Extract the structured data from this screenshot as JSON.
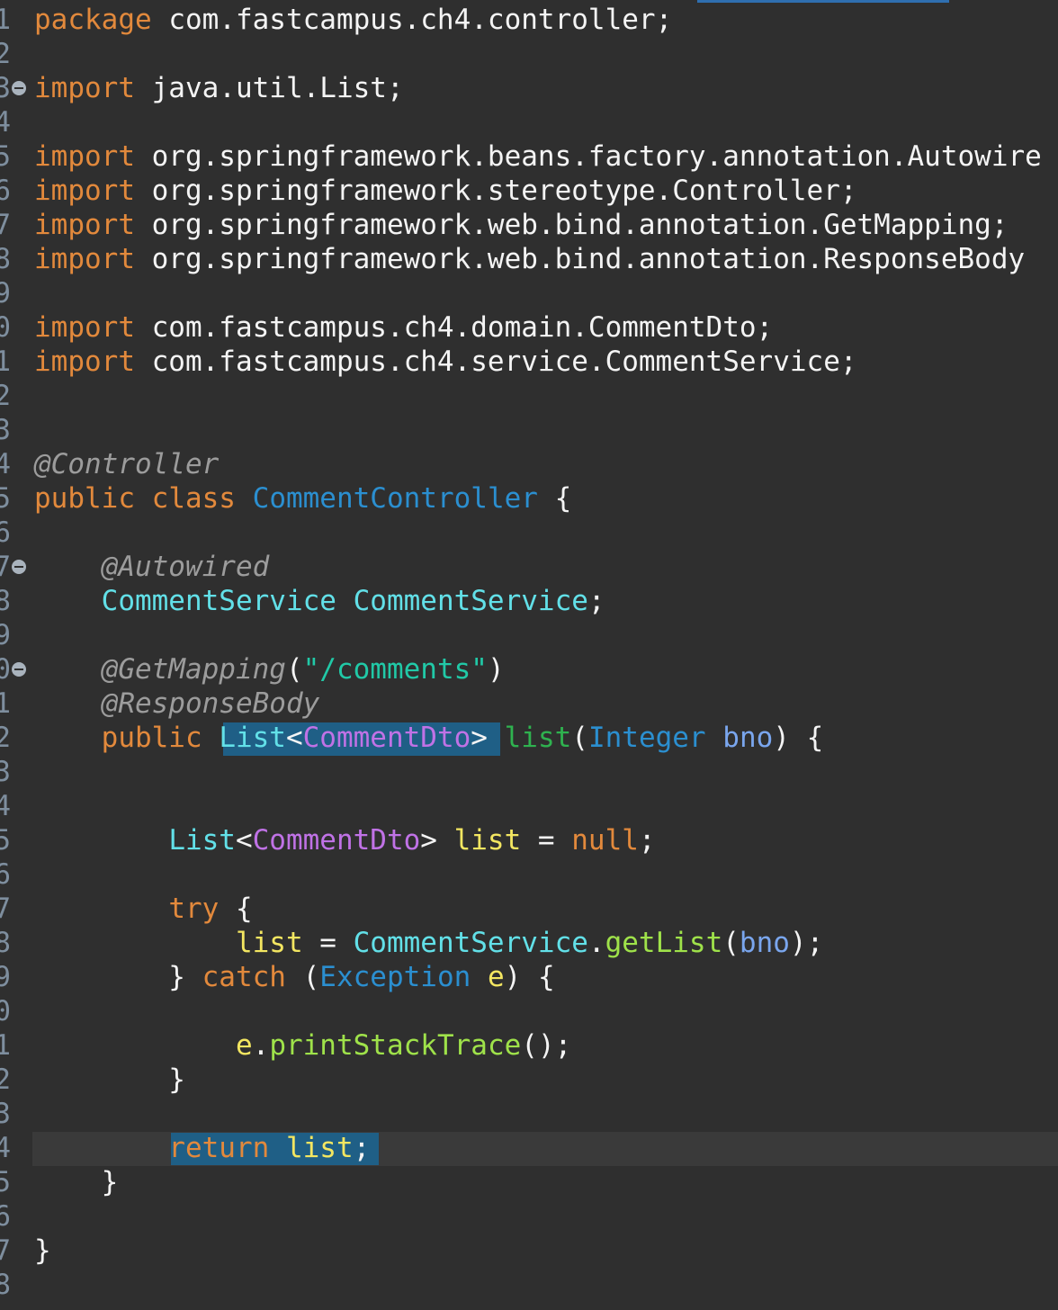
{
  "editor": {
    "file_language": "java",
    "line_numbers": [
      "1",
      "2",
      "3",
      "4",
      "5",
      "6",
      "7",
      "8",
      "9",
      "0",
      "1",
      "2",
      "3",
      "4",
      "5",
      "6",
      "7",
      "8",
      "9",
      "0",
      "1",
      "2",
      "3",
      "4",
      "5",
      "6",
      "7",
      "8",
      "9",
      "0",
      "1",
      "2",
      "3",
      "4",
      "5",
      "6",
      "7",
      "8"
    ],
    "lines": [
      {
        "text": "package com.fastcampus.ch4.controller;",
        "tokens": [
          {
            "t": "package",
            "c": "kw"
          },
          {
            "t": " com.fastcampus.ch4.controller;"
          }
        ]
      },
      {
        "text": "",
        "tokens": []
      },
      {
        "text": "import java.util.List;",
        "fold": true,
        "tokens": [
          {
            "t": "import",
            "c": "kw"
          },
          {
            "t": " java.util.List;"
          }
        ]
      },
      {
        "text": "",
        "tokens": []
      },
      {
        "text": "import org.springframework.beans.factory.annotation.Autowire",
        "tokens": [
          {
            "t": "import",
            "c": "kw"
          },
          {
            "t": " org.springframework.beans.factory.annotation.Autowire"
          }
        ]
      },
      {
        "text": "import org.springframework.stereotype.Controller;",
        "tokens": [
          {
            "t": "import",
            "c": "kw"
          },
          {
            "t": " org.springframework.stereotype.Controller;"
          }
        ]
      },
      {
        "text": "import org.springframework.web.bind.annotation.GetMapping;",
        "tokens": [
          {
            "t": "import",
            "c": "kw"
          },
          {
            "t": " org.springframework.web.bind.annotation.GetMapping;"
          }
        ]
      },
      {
        "text": "import org.springframework.web.bind.annotation.ResponseBody",
        "tokens": [
          {
            "t": "import",
            "c": "kw"
          },
          {
            "t": " org.springframework.web.bind.annotation.ResponseBody"
          }
        ]
      },
      {
        "text": "",
        "tokens": []
      },
      {
        "text": "import com.fastcampus.ch4.domain.CommentDto;",
        "tokens": [
          {
            "t": "import",
            "c": "kw"
          },
          {
            "t": " com.fastcampus.ch4.domain.CommentDto;"
          }
        ]
      },
      {
        "text": "import com.fastcampus.ch4.service.CommentService;",
        "tokens": [
          {
            "t": "import",
            "c": "kw"
          },
          {
            "t": " com.fastcampus.ch4.service.CommentService;"
          }
        ]
      },
      {
        "text": "",
        "tokens": []
      },
      {
        "text": "",
        "tokens": []
      },
      {
        "text": "@Controller",
        "tokens": [
          {
            "t": "@Controller",
            "c": "ann"
          }
        ]
      },
      {
        "text": "public class CommentController {",
        "tokens": [
          {
            "t": "public",
            "c": "kw"
          },
          {
            "t": " "
          },
          {
            "t": "class",
            "c": "kw"
          },
          {
            "t": " "
          },
          {
            "t": "CommentController",
            "c": "type"
          },
          {
            "t": " {"
          }
        ]
      },
      {
        "text": "",
        "tokens": []
      },
      {
        "text": "    @Autowired",
        "fold": true,
        "tokens": [
          {
            "t": "    "
          },
          {
            "t": "@Autowired",
            "c": "ann"
          }
        ]
      },
      {
        "text": "    CommentService CommentService;",
        "tokens": [
          {
            "t": "    "
          },
          {
            "t": "CommentService",
            "c": "field"
          },
          {
            "t": " "
          },
          {
            "t": "CommentService",
            "c": "field"
          },
          {
            "t": ";"
          }
        ]
      },
      {
        "text": "",
        "tokens": []
      },
      {
        "text": "    @GetMapping(\"/comments\")",
        "fold": true,
        "tokens": [
          {
            "t": "    "
          },
          {
            "t": "@GetMapping",
            "c": "ann"
          },
          {
            "t": "("
          },
          {
            "t": "\"/comments\"",
            "c": "str"
          },
          {
            "t": ")"
          }
        ]
      },
      {
        "text": "    @ResponseBody",
        "tokens": [
          {
            "t": "    "
          },
          {
            "t": "@ResponseBody",
            "c": "ann"
          }
        ]
      },
      {
        "text": "    public List<CommentDto> list(Integer bno) {",
        "tokens": [
          {
            "t": "    "
          },
          {
            "t": "public",
            "c": "kw"
          },
          {
            "t": " "
          },
          {
            "t": "List",
            "c": "field"
          },
          {
            "t": "<"
          },
          {
            "t": "CommentDto",
            "c": "gen"
          },
          {
            "t": ">"
          },
          {
            "t": " "
          },
          {
            "t": "list",
            "c": "mk"
          },
          {
            "t": "("
          },
          {
            "t": "Integer",
            "c": "type"
          },
          {
            "t": " "
          },
          {
            "t": "bno",
            "c": "param"
          },
          {
            "t": ") {"
          }
        ]
      },
      {
        "text": "",
        "tokens": []
      },
      {
        "text": "",
        "tokens": []
      },
      {
        "text": "        List<CommentDto> list = null;",
        "tokens": [
          {
            "t": "        "
          },
          {
            "t": "List",
            "c": "field"
          },
          {
            "t": "<"
          },
          {
            "t": "CommentDto",
            "c": "gen"
          },
          {
            "t": "> "
          },
          {
            "t": "list",
            "c": "lvar"
          },
          {
            "t": " = "
          },
          {
            "t": "null",
            "c": "kw"
          },
          {
            "t": ";"
          }
        ]
      },
      {
        "text": "",
        "tokens": []
      },
      {
        "text": "        try {",
        "tokens": [
          {
            "t": "        "
          },
          {
            "t": "try",
            "c": "kw"
          },
          {
            "t": " {"
          }
        ]
      },
      {
        "text": "            list = CommentService.getList(bno);",
        "tokens": [
          {
            "t": "            "
          },
          {
            "t": "list",
            "c": "lvar"
          },
          {
            "t": " = "
          },
          {
            "t": "CommentService",
            "c": "field"
          },
          {
            "t": "."
          },
          {
            "t": "getList",
            "c": "meth"
          },
          {
            "t": "("
          },
          {
            "t": "bno",
            "c": "param"
          },
          {
            "t": ");"
          }
        ]
      },
      {
        "text": "        } catch (Exception e) {",
        "tokens": [
          {
            "t": "        } "
          },
          {
            "t": "catch",
            "c": "kw"
          },
          {
            "t": " ("
          },
          {
            "t": "Exception",
            "c": "type"
          },
          {
            "t": " "
          },
          {
            "t": "e",
            "c": "lvar"
          },
          {
            "t": ") {"
          }
        ]
      },
      {
        "text": "",
        "tokens": []
      },
      {
        "text": "            e.printStackTrace();",
        "tokens": [
          {
            "t": "            "
          },
          {
            "t": "e",
            "c": "lvar"
          },
          {
            "t": "."
          },
          {
            "t": "printStackTrace",
            "c": "meth"
          },
          {
            "t": "();"
          }
        ]
      },
      {
        "text": "        }",
        "tokens": [
          {
            "t": "        }"
          }
        ]
      },
      {
        "text": "",
        "tokens": []
      },
      {
        "text": "        return list;",
        "tokens": [
          {
            "t": "        "
          },
          {
            "t": "return",
            "c": "kw"
          },
          {
            "t": " "
          },
          {
            "t": "list",
            "c": "lvar"
          },
          {
            "t": ";"
          }
        ]
      },
      {
        "text": "    }",
        "tokens": [
          {
            "t": "    }"
          }
        ]
      },
      {
        "text": "",
        "tokens": []
      },
      {
        "text": "}",
        "tokens": [
          {
            "t": "}"
          }
        ]
      },
      {
        "text": "",
        "tokens": []
      }
    ],
    "colors": {
      "background": "#2f2f2f",
      "keyword": "#e2893c",
      "annotation": "#9c9c9c",
      "type": "#2b8fd0",
      "field": "#62e0e8",
      "generic": "#c072e6",
      "local_variable": "#f3e661",
      "string": "#21c9a7",
      "method": "#9fe24a",
      "parameter": "#7aa6ee",
      "selection": "#1f5f86"
    }
  }
}
